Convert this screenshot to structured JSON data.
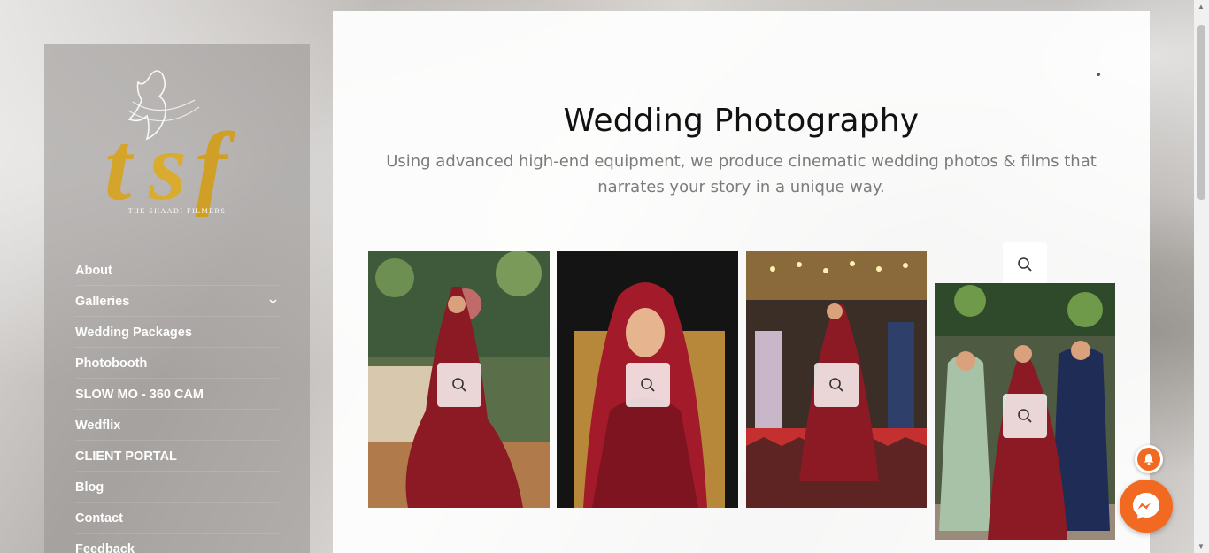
{
  "brand": {
    "logo_text": "tsf",
    "tagline": "THE SHAADI FILMERS"
  },
  "nav": {
    "items": [
      {
        "label": "About",
        "has_submenu": false
      },
      {
        "label": "Galleries",
        "has_submenu": true
      },
      {
        "label": "Wedding Packages",
        "has_submenu": false
      },
      {
        "label": "Photobooth",
        "has_submenu": false
      },
      {
        "label": "SLOW MO - 360 CAM",
        "has_submenu": false
      },
      {
        "label": "Wedflix",
        "has_submenu": false
      },
      {
        "label": "CLIENT PORTAL",
        "has_submenu": false
      },
      {
        "label": "Blog",
        "has_submenu": false
      },
      {
        "label": "Contact",
        "has_submenu": false
      },
      {
        "label": "Feedback",
        "has_submenu": false
      }
    ],
    "submenu_icon": "chevron-down-icon"
  },
  "main": {
    "title": "Wedding Photography",
    "subtitle": "Using advanced high-end equipment, we produce cinematic wedding photos & films that narrates your story in a unique way."
  },
  "gallery": {
    "zoom_icon": "magnifier-icon",
    "items": [
      {
        "scene": "bride-in-red-lehenga-standing-by-sofa"
      },
      {
        "scene": "smiling-bride-seated-on-gold-chair"
      },
      {
        "scene": "bride-walking-in-on-checkered-floor"
      },
      {
        "scene": "bride-with-family-posing"
      }
    ]
  },
  "widgets": {
    "notification_icon": "bell-icon",
    "chat_icon": "messenger-icon"
  },
  "colors": {
    "accent": "#f26a21",
    "logo_gold": "#d4a52a",
    "bridal_red": "#8b1a24"
  }
}
